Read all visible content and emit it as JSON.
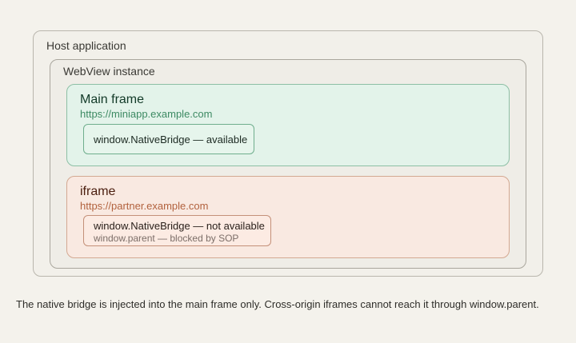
{
  "host": {
    "label": "Host application"
  },
  "webview": {
    "label": "WebView instance"
  },
  "main_frame": {
    "title": "Main frame",
    "url": "https://miniapp.example.com",
    "bridge_status": "window.NativeBridge — available"
  },
  "iframe": {
    "title": "iframe",
    "url": "https://partner.example.com",
    "bridge_status": "window.NativeBridge — not available",
    "parent_status": "window.parent — blocked by SOP"
  },
  "caption": "The native bridge is injected into the main frame only. Cross-origin iframes cannot reach it through window.parent.",
  "colors": {
    "main_frame_fill": "#e3f3ea",
    "main_frame_border": "#8dbfa5",
    "iframe_fill": "#f9e9e1",
    "iframe_border": "#d3a891",
    "background": "#f4f2ec"
  }
}
